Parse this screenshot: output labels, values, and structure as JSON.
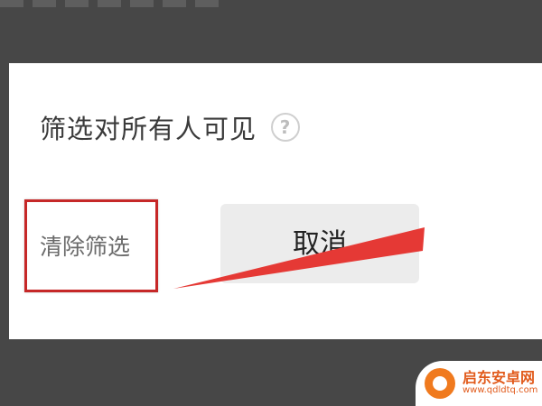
{
  "dialog": {
    "title": "筛选对所有人可见",
    "help_icon": "question-circle-icon",
    "clear_filter_label": "清除筛选",
    "cancel_label": "取消"
  },
  "annotation": {
    "box_color": "#c62828",
    "arrow_color": "#e53935"
  },
  "watermark": {
    "name": "启东安卓网",
    "url": "www.qdldtq.com"
  },
  "colors": {
    "backdrop": "#474747",
    "panel": "#ffffff",
    "button_bg": "#ececec"
  }
}
